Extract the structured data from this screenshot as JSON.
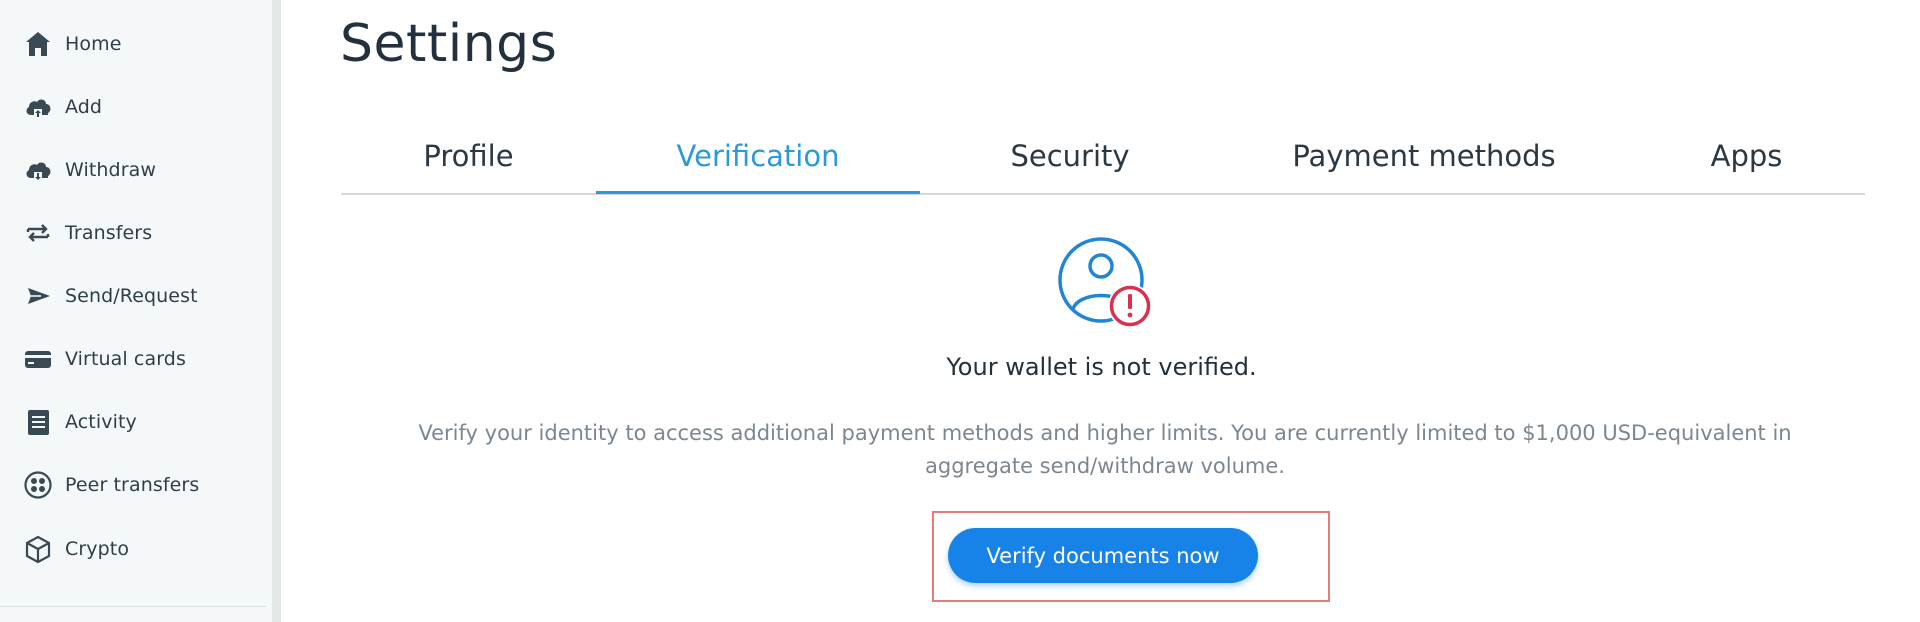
{
  "sidebar": {
    "items": [
      {
        "label": "Home",
        "icon": "home-icon"
      },
      {
        "label": "Add",
        "icon": "cloud-add-icon"
      },
      {
        "label": "Withdraw",
        "icon": "cloud-withdraw-icon"
      },
      {
        "label": "Transfers",
        "icon": "transfer-arrows-icon"
      },
      {
        "label": "Send/Request",
        "icon": "send-plane-icon"
      },
      {
        "label": "Virtual cards",
        "icon": "credit-card-icon"
      },
      {
        "label": "Activity",
        "icon": "document-list-icon"
      },
      {
        "label": "Peer transfers",
        "icon": "peer-network-icon"
      },
      {
        "label": "Crypto",
        "icon": "cube-icon"
      }
    ]
  },
  "page": {
    "title": "Settings"
  },
  "tabs": [
    {
      "label": "Profile",
      "active": false
    },
    {
      "label": "Verification",
      "active": true
    },
    {
      "label": "Security",
      "active": false
    },
    {
      "label": "Payment methods",
      "active": false
    },
    {
      "label": "Apps",
      "active": false
    }
  ],
  "verification": {
    "icon": "user-warning-icon",
    "title": "Your wallet is not verified.",
    "description": "Verify your identity to access additional payment methods and higher limits. You are currently limited to $1,000 USD-equivalent in aggregate send/withdraw volume.",
    "button_label": "Verify documents now"
  },
  "colors": {
    "accent": "#2b9ad8",
    "button": "#1783e8",
    "warning": "#d9304f",
    "highlight": "#e27d78"
  }
}
